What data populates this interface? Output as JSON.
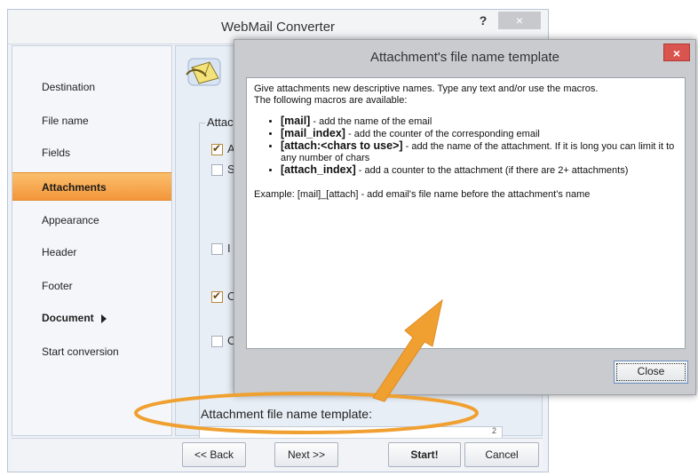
{
  "window": {
    "title": "WebMail Converter",
    "help_label": "?",
    "close_label": "×"
  },
  "sidebar": {
    "items": [
      {
        "label": "Destination",
        "active": false
      },
      {
        "label": "File name",
        "active": false
      },
      {
        "label": "Fields",
        "active": false
      },
      {
        "label": "Attachments",
        "active": true
      },
      {
        "label": "Appearance",
        "active": false
      },
      {
        "label": "Header",
        "active": false
      },
      {
        "label": "Footer",
        "active": false
      },
      {
        "label": "Document",
        "active": false
      },
      {
        "label": "Start conversion",
        "active": false
      }
    ]
  },
  "content": {
    "group_label": "Attacl",
    "checkboxes": [
      {
        "label": "A",
        "checked": true
      },
      {
        "label": "S",
        "checked": false
      },
      {
        "label": "I",
        "checked": false
      },
      {
        "label": "C",
        "checked": true
      },
      {
        "label": "C",
        "checked": false
      }
    ],
    "template_label": "Attachment file name template:",
    "template_field_tail": "2"
  },
  "bottom_bar": {
    "back": "<< Back",
    "next": "Next >>",
    "start": "Start!",
    "cancel": "Cancel"
  },
  "dialog": {
    "title": "Attachment's file name template",
    "close_icon_label": "×",
    "intro_line1": "Give attachments new descriptive names. Type any text and/or use the macros.",
    "intro_line2": "The following macros are available:",
    "macros": [
      {
        "name": "[mail]",
        "desc": " - add the name of the email"
      },
      {
        "name": "[mail_index]",
        "desc": " - add the counter of the corresponding email"
      },
      {
        "name": "[attach:<chars to use>]",
        "desc": " - add the name of the attachment. If it is long you can limit it to any number of chars"
      },
      {
        "name": "[attach_index]",
        "desc": " - add a counter to the attachment (if there are 2+ attachments)"
      }
    ],
    "example": "Example: [mail]_[attach] - add email's file name before the attachment's name",
    "close_button": "Close"
  },
  "colors": {
    "active_nav": "#f3963a",
    "annotation": "#f0a030",
    "dialog_close": "#d9534f"
  }
}
